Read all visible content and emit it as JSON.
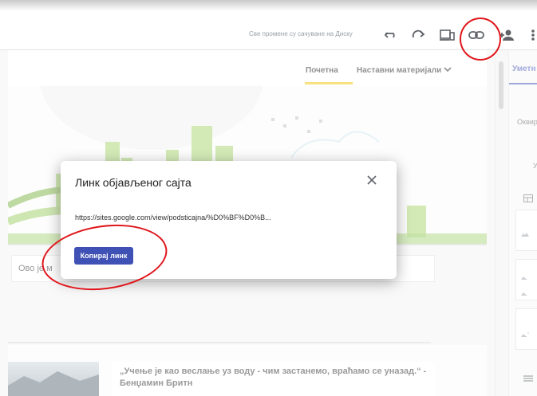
{
  "toolbar": {
    "saved_status": "Све промене су сачуване на Диску",
    "icons": [
      "undo-icon",
      "redo-icon",
      "preview-device-icon",
      "link-icon",
      "add-person-icon",
      "more-vert-icon"
    ]
  },
  "site": {
    "nav": {
      "home": "Почетна",
      "materials": "Наставни материјали"
    },
    "textbox_text": "Ово је м",
    "quote": "„Учење је као веслање уз воду - чим застанемо, враћамо се уназад.“ - Бенџамин Бритн"
  },
  "right_panel": {
    "tab": "Уметн",
    "label1": "Оквир",
    "label2": "У"
  },
  "dialog": {
    "title": "Линк објављеног сајта",
    "url": "https://sites.google.com/view/podsticajna/%D0%BF%D0%B...",
    "copy_button": "Копирај линк"
  },
  "colors": {
    "accent": "#3f51b5",
    "nav_underline": "#f2c200",
    "annotation": "#e0161b",
    "hero_green": "#8bc34a"
  }
}
